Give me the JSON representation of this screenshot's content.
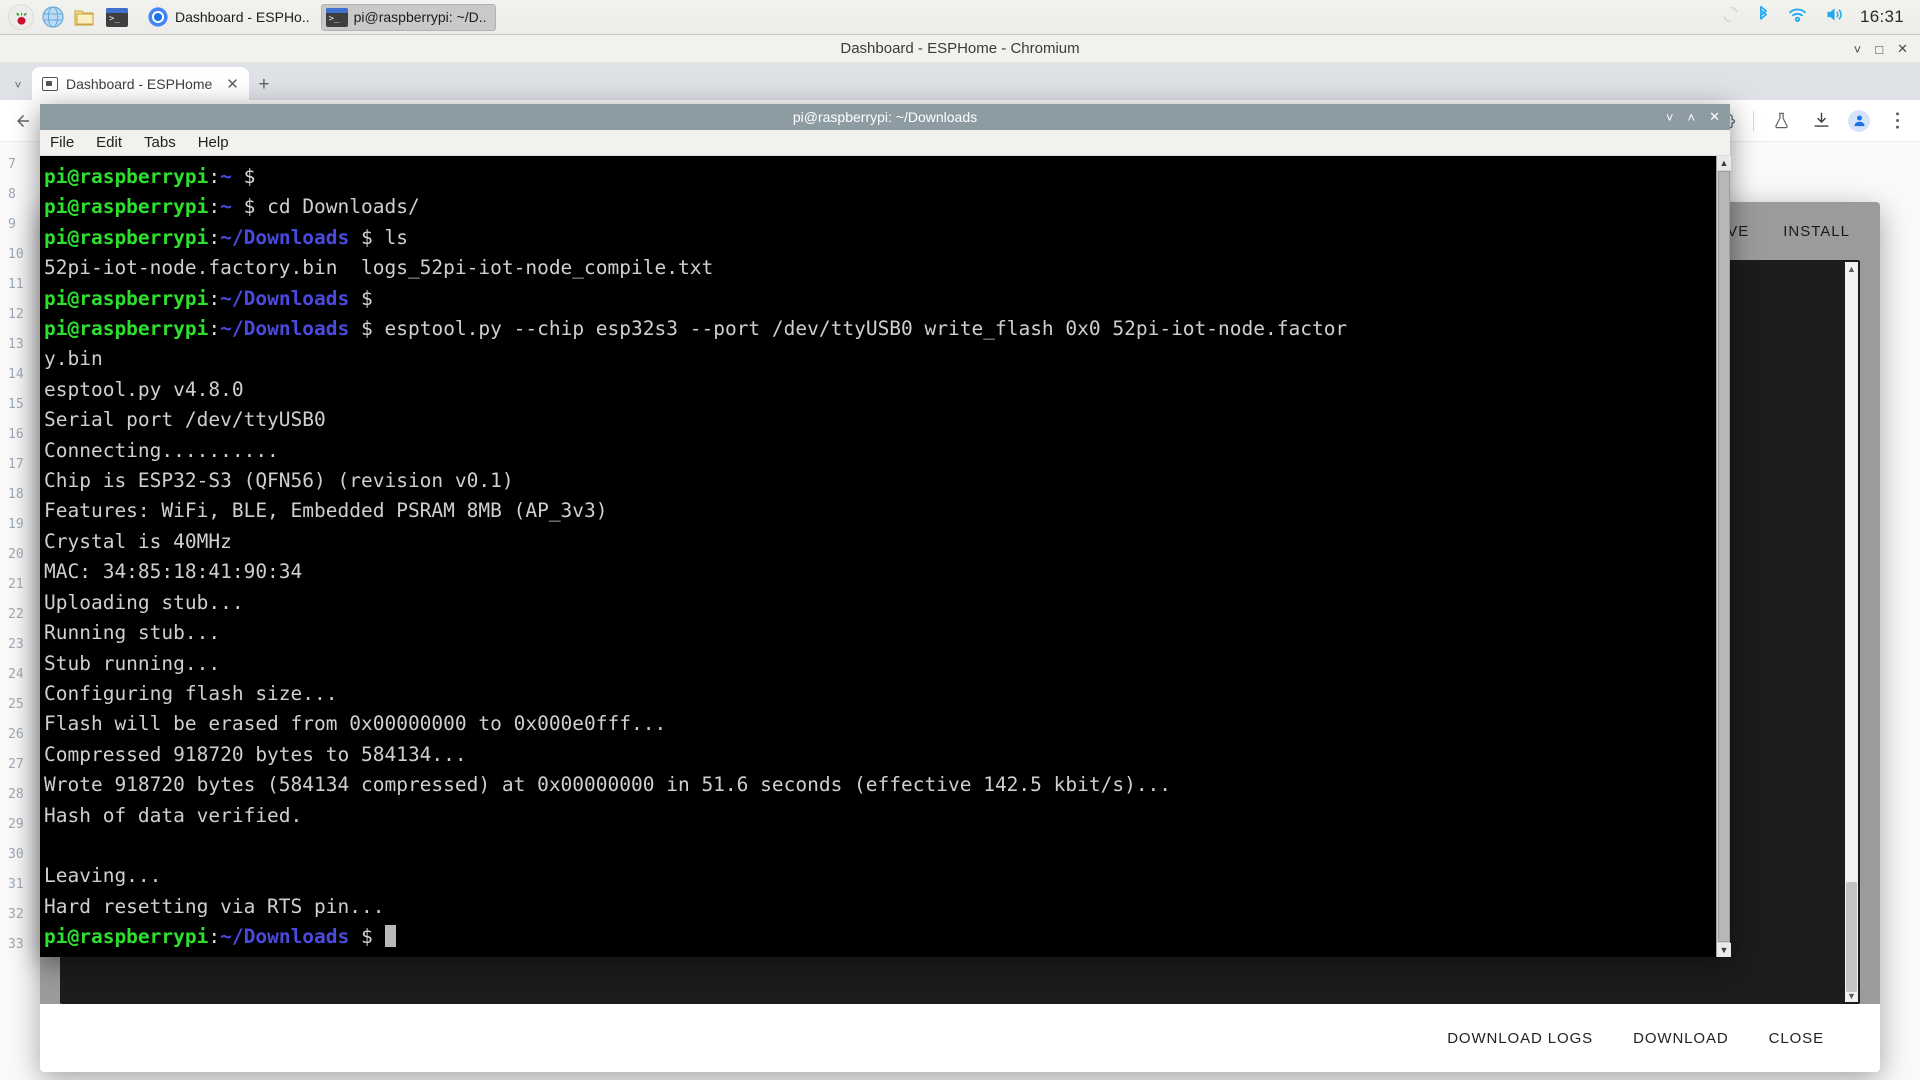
{
  "taskbar": {
    "launchers": [
      {
        "name": "raspberry-menu",
        "icon": "raspberry-icon"
      },
      {
        "name": "web-browser",
        "icon": "globe-icon"
      },
      {
        "name": "file-manager",
        "icon": "folder-icon"
      },
      {
        "name": "terminal",
        "icon": "terminal-icon"
      }
    ],
    "windows": [
      {
        "label": "Dashboard - ESPHo..",
        "icon": "chromium-icon",
        "active": false
      },
      {
        "label": "pi@raspberrypi: ~/D..",
        "icon": "terminal-icon",
        "active": true
      }
    ],
    "tray": [
      {
        "name": "updates-icon",
        "glyph": "⟳"
      },
      {
        "name": "bluetooth-icon",
        "glyph": "ᛗ"
      },
      {
        "name": "wifi-icon",
        "glyph": "◠"
      },
      {
        "name": "volume-icon",
        "glyph": "ὐA"
      }
    ],
    "clock": "16:31"
  },
  "chromium": {
    "window_title": "Dashboard - ESPHome - Chromium",
    "window_buttons": {
      "minimize": "˅",
      "maximize": "□",
      "close": "✕"
    },
    "tab": {
      "title": "Dashboard - ESPHome",
      "close": "✕"
    },
    "new_tab": "+",
    "tab_list": "˅",
    "toolbar_icons": [
      {
        "name": "extensions-icon"
      },
      {
        "name": "labs-flask-icon"
      },
      {
        "name": "downloads-icon"
      },
      {
        "name": "profile-avatar"
      },
      {
        "name": "chrome-menu-icon"
      }
    ]
  },
  "esphome": {
    "header_buttons": [
      {
        "name": "save-button",
        "label": "SAVE"
      },
      {
        "name": "install-button",
        "label": "INSTALL"
      }
    ],
    "footer_buttons": [
      {
        "name": "download-logs-button",
        "label": "DOWNLOAD LOGS"
      },
      {
        "name": "download-button",
        "label": "DOWNLOAD"
      },
      {
        "name": "close-button",
        "label": "CLOSE"
      }
    ]
  },
  "terminal": {
    "title": "pi@raspberrypi: ~/Downloads",
    "window_buttons": {
      "minimize": "˅",
      "maximize": "˄",
      "close": "✕"
    },
    "menus": [
      "File",
      "Edit",
      "Tabs",
      "Help"
    ],
    "prompt": {
      "user_host": "pi@raspberrypi",
      "colon": ":",
      "dollar": "$"
    },
    "lines": [
      {
        "type": "prompt",
        "path": "~",
        "command": ""
      },
      {
        "type": "prompt",
        "path": "~",
        "command": "cd Downloads/"
      },
      {
        "type": "prompt",
        "path": "~/Downloads",
        "command": "ls"
      },
      {
        "type": "output",
        "text": "52pi-iot-node.factory.bin  logs_52pi-iot-node_compile.txt"
      },
      {
        "type": "prompt",
        "path": "~/Downloads",
        "command": ""
      },
      {
        "type": "prompt",
        "path": "~/Downloads",
        "command": "esptool.py --chip esp32s3 --port /dev/ttyUSB0 write_flash 0x0 52pi-iot-node.factor"
      },
      {
        "type": "output",
        "text": "y.bin"
      },
      {
        "type": "output",
        "text": "esptool.py v4.8.0"
      },
      {
        "type": "output",
        "text": "Serial port /dev/ttyUSB0"
      },
      {
        "type": "output",
        "text": "Connecting.........."
      },
      {
        "type": "output",
        "text": "Chip is ESP32-S3 (QFN56) (revision v0.1)"
      },
      {
        "type": "output",
        "text": "Features: WiFi, BLE, Embedded PSRAM 8MB (AP_3v3)"
      },
      {
        "type": "output",
        "text": "Crystal is 40MHz"
      },
      {
        "type": "output",
        "text": "MAC: 34:85:18:41:90:34"
      },
      {
        "type": "output",
        "text": "Uploading stub..."
      },
      {
        "type": "output",
        "text": "Running stub..."
      },
      {
        "type": "output",
        "text": "Stub running..."
      },
      {
        "type": "output",
        "text": "Configuring flash size..."
      },
      {
        "type": "output",
        "text": "Flash will be erased from 0x00000000 to 0x000e0fff..."
      },
      {
        "type": "output",
        "text": "Compressed 918720 bytes to 584134..."
      },
      {
        "type": "output",
        "text": "Wrote 918720 bytes (584134 compressed) at 0x00000000 in 51.6 seconds (effective 142.5 kbit/s)..."
      },
      {
        "type": "output",
        "text": "Hash of data verified."
      },
      {
        "type": "output",
        "text": ""
      },
      {
        "type": "output",
        "text": "Leaving..."
      },
      {
        "type": "output",
        "text": "Hard resetting via RTS pin..."
      },
      {
        "type": "prompt",
        "path": "~/Downloads",
        "command": "",
        "cursor": true
      }
    ]
  },
  "colors": {
    "prompt_user": "#2ee02e",
    "prompt_path": "#4a4ae0",
    "terminal_fg": "#d0d0d0",
    "terminal_bg": "#000000",
    "titlebar": "#8d9ca3",
    "dialog_bg": "#9b9b9b"
  }
}
